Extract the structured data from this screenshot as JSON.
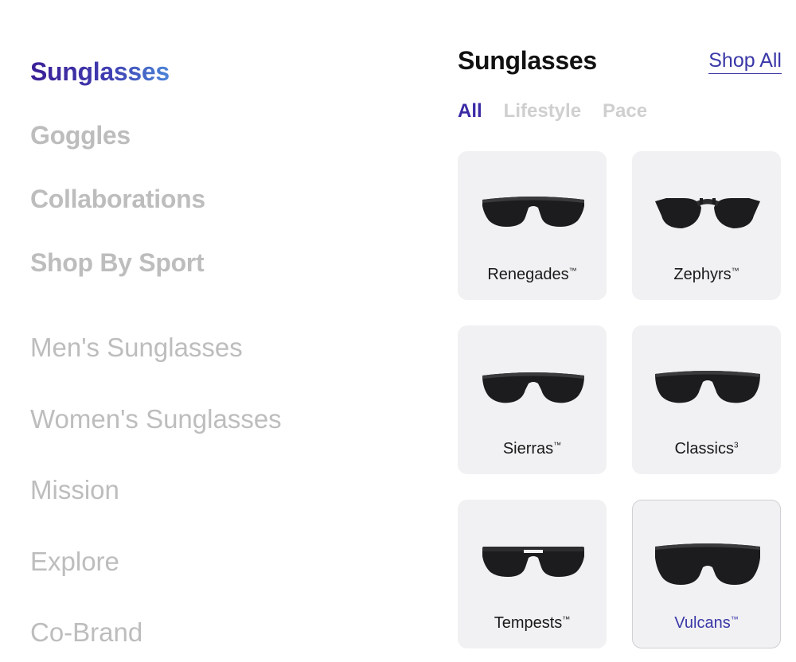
{
  "left_nav": {
    "primary": [
      {
        "label": "Sunglasses",
        "active": true
      },
      {
        "label": "Goggles",
        "active": false
      },
      {
        "label": "Collaborations",
        "active": false
      },
      {
        "label": "Shop By Sport",
        "active": false
      }
    ],
    "secondary": [
      {
        "label": "Men's Sunglasses"
      },
      {
        "label": "Women's Sunglasses"
      },
      {
        "label": "Mission"
      },
      {
        "label": "Explore"
      },
      {
        "label": "Co-Brand"
      }
    ]
  },
  "panel": {
    "title": "Sunglasses",
    "shop_all_label": "Shop All",
    "filters": [
      {
        "label": "All",
        "active": true
      },
      {
        "label": "Lifestyle",
        "active": false
      },
      {
        "label": "Pace",
        "active": false
      }
    ],
    "products": [
      {
        "name": "Renegades",
        "mark": "™",
        "icon": "renegades-sunglasses-icon"
      },
      {
        "name": "Zephyrs",
        "mark": "™",
        "icon": "zephyrs-sunglasses-icon"
      },
      {
        "name": "Sierras",
        "mark": "™",
        "icon": "sierras-sunglasses-icon"
      },
      {
        "name": "Classics",
        "mark": "3",
        "icon": "classics-sunglasses-icon"
      },
      {
        "name": "Tempests",
        "mark": "™",
        "icon": "tempests-sunglasses-icon"
      },
      {
        "name": "Vulcans",
        "mark": "™",
        "icon": "vulcans-sunglasses-icon"
      }
    ]
  },
  "colors": {
    "accent": "#3a38a8",
    "active_gradient_start": "#3b1f96",
    "active_gradient_end": "#4a85d8",
    "muted_text": "#bdbdbd",
    "card_bg": "#f1f1f3"
  }
}
